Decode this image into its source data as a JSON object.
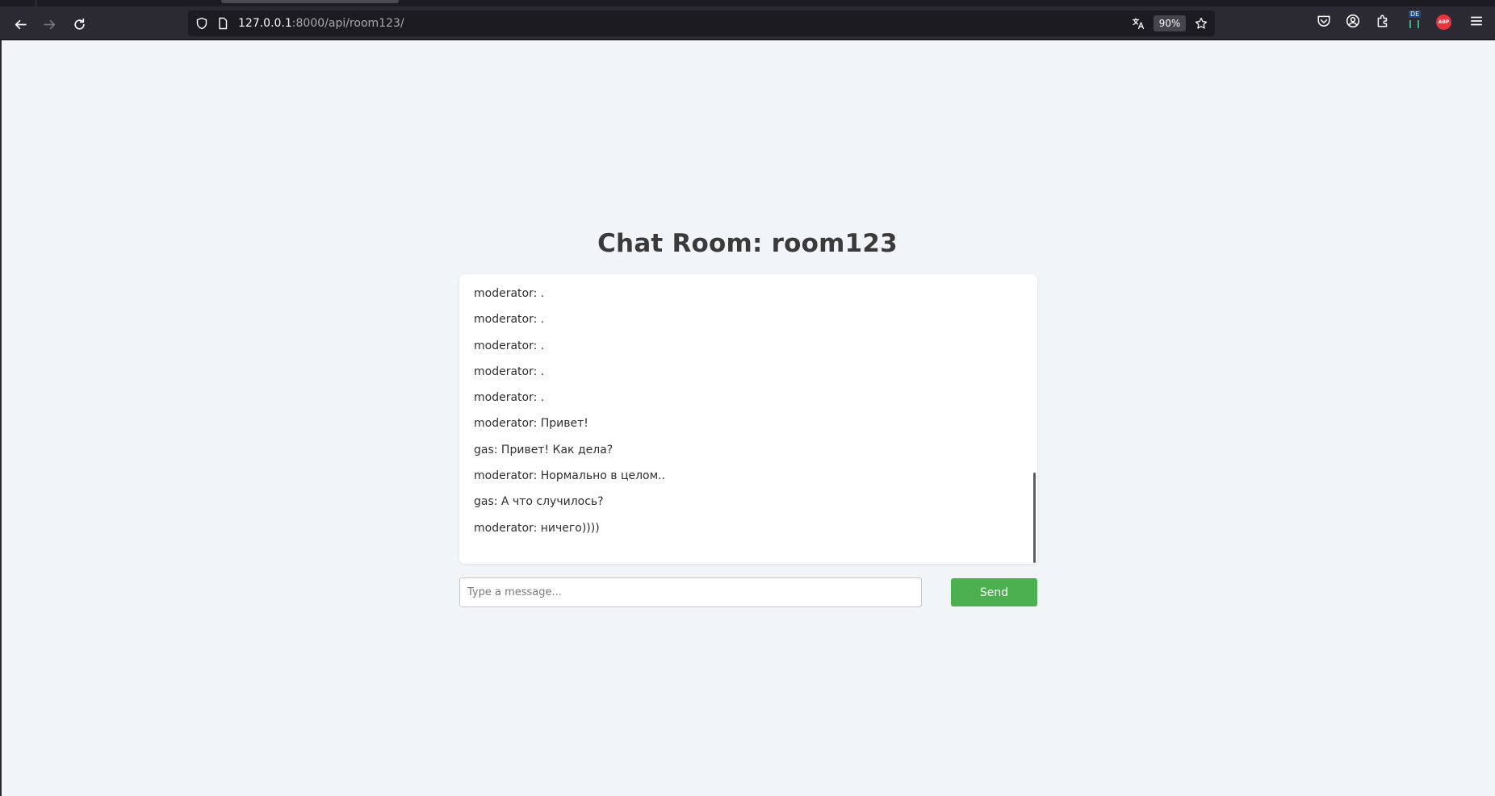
{
  "browser": {
    "url_host": "127.0.0.1",
    "url_rest": ":8000/api/room123/",
    "zoom": "90%",
    "extension_badges": {
      "de": "DE",
      "abp": "ABP"
    },
    "icons": {
      "back": "arrow-left-icon",
      "forward": "arrow-right-icon",
      "reload": "reload-icon",
      "tracking": "shield-icon",
      "page": "page-icon",
      "translate": "translate-icon",
      "bookmark": "star-icon",
      "pocket": "pocket-icon",
      "account": "account-icon",
      "extensions": "puzzle-icon",
      "menu": "hamburger-menu-icon"
    }
  },
  "chat": {
    "title": "Chat Room: room123",
    "messages": [
      "moderator: .",
      "moderator: .",
      "moderator: .",
      "moderator: .",
      "moderator: .",
      "moderator: Привет!",
      "gas: Привет! Как дела?",
      "moderator: Нормально в целом..",
      "gas: А что случилось?",
      "moderator: ничего))))"
    ],
    "input_placeholder": "Type a message...",
    "input_value": "",
    "send_label": "Send"
  },
  "colors": {
    "page_bg": "#f2f5f8",
    "send_button": "#4caf50",
    "chrome_bg": "#2b2a33",
    "abp_badge": "#e8353d"
  }
}
